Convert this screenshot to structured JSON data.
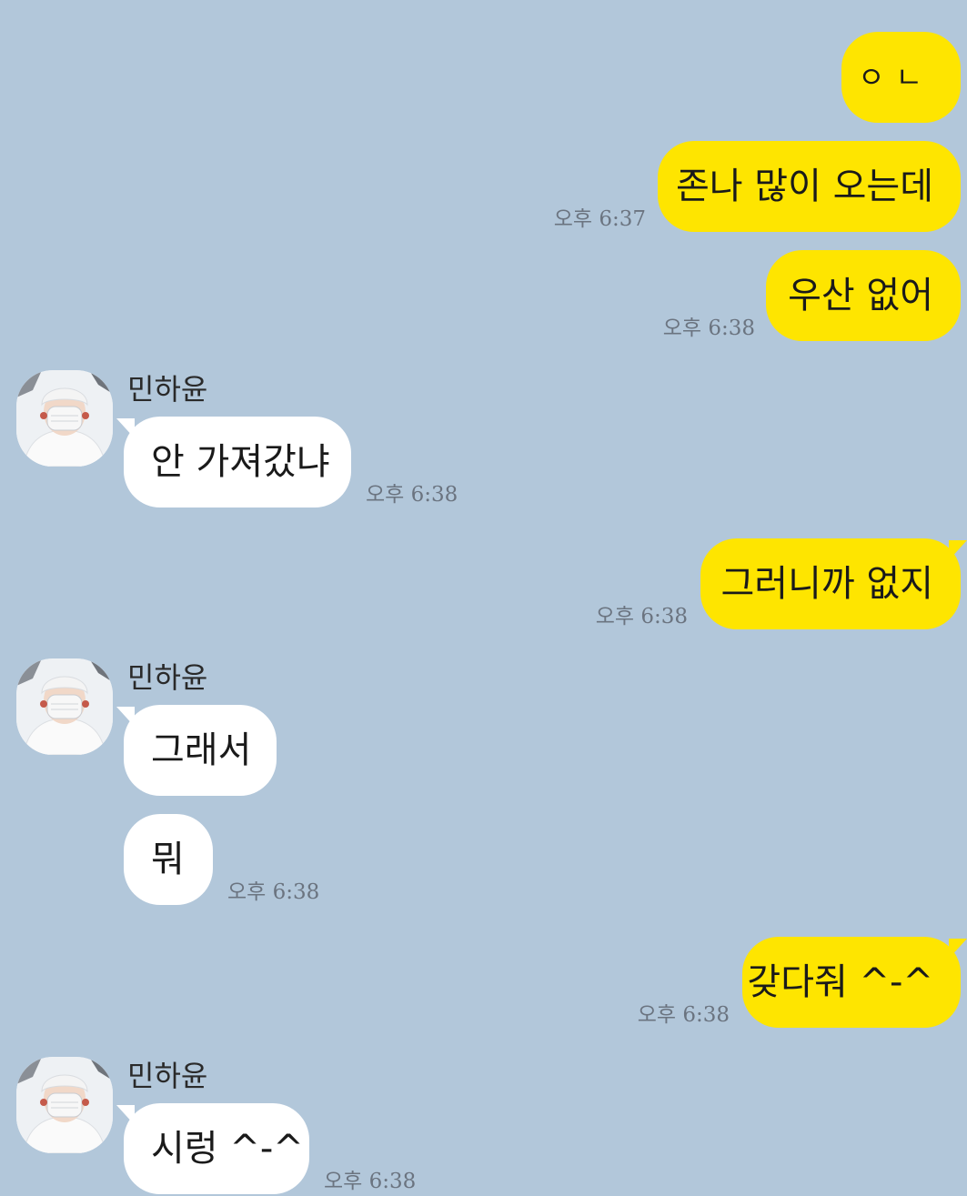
{
  "contact": {
    "name": "민하윤"
  },
  "messages": [
    {
      "from": "me",
      "text": "ㅇㄴ",
      "time": ""
    },
    {
      "from": "me",
      "text": "존나 많이 오는데",
      "time": "오후 6:37"
    },
    {
      "from": "me",
      "text": "우산 없어",
      "time": "오후 6:38"
    },
    {
      "from": "other",
      "text": "안 가져갔냐",
      "time": "오후 6:38"
    },
    {
      "from": "me",
      "text": "그러니까 없지",
      "time": "오후 6:38"
    },
    {
      "from": "other",
      "text": "그래서",
      "time": ""
    },
    {
      "from": "other",
      "text": "뭐",
      "time": "오후 6:38"
    },
    {
      "from": "me",
      "text": "갖다줘 ^-^",
      "time": "오후 6:38"
    },
    {
      "from": "other",
      "text": "시렁 ^-^",
      "time": "오후 6:38"
    }
  ],
  "colors": {
    "background": "#b2c7da",
    "my_bubble": "#fee500",
    "other_bubble": "#ffffff"
  },
  "icons": {
    "avatar": "profile-photo-avatar"
  }
}
